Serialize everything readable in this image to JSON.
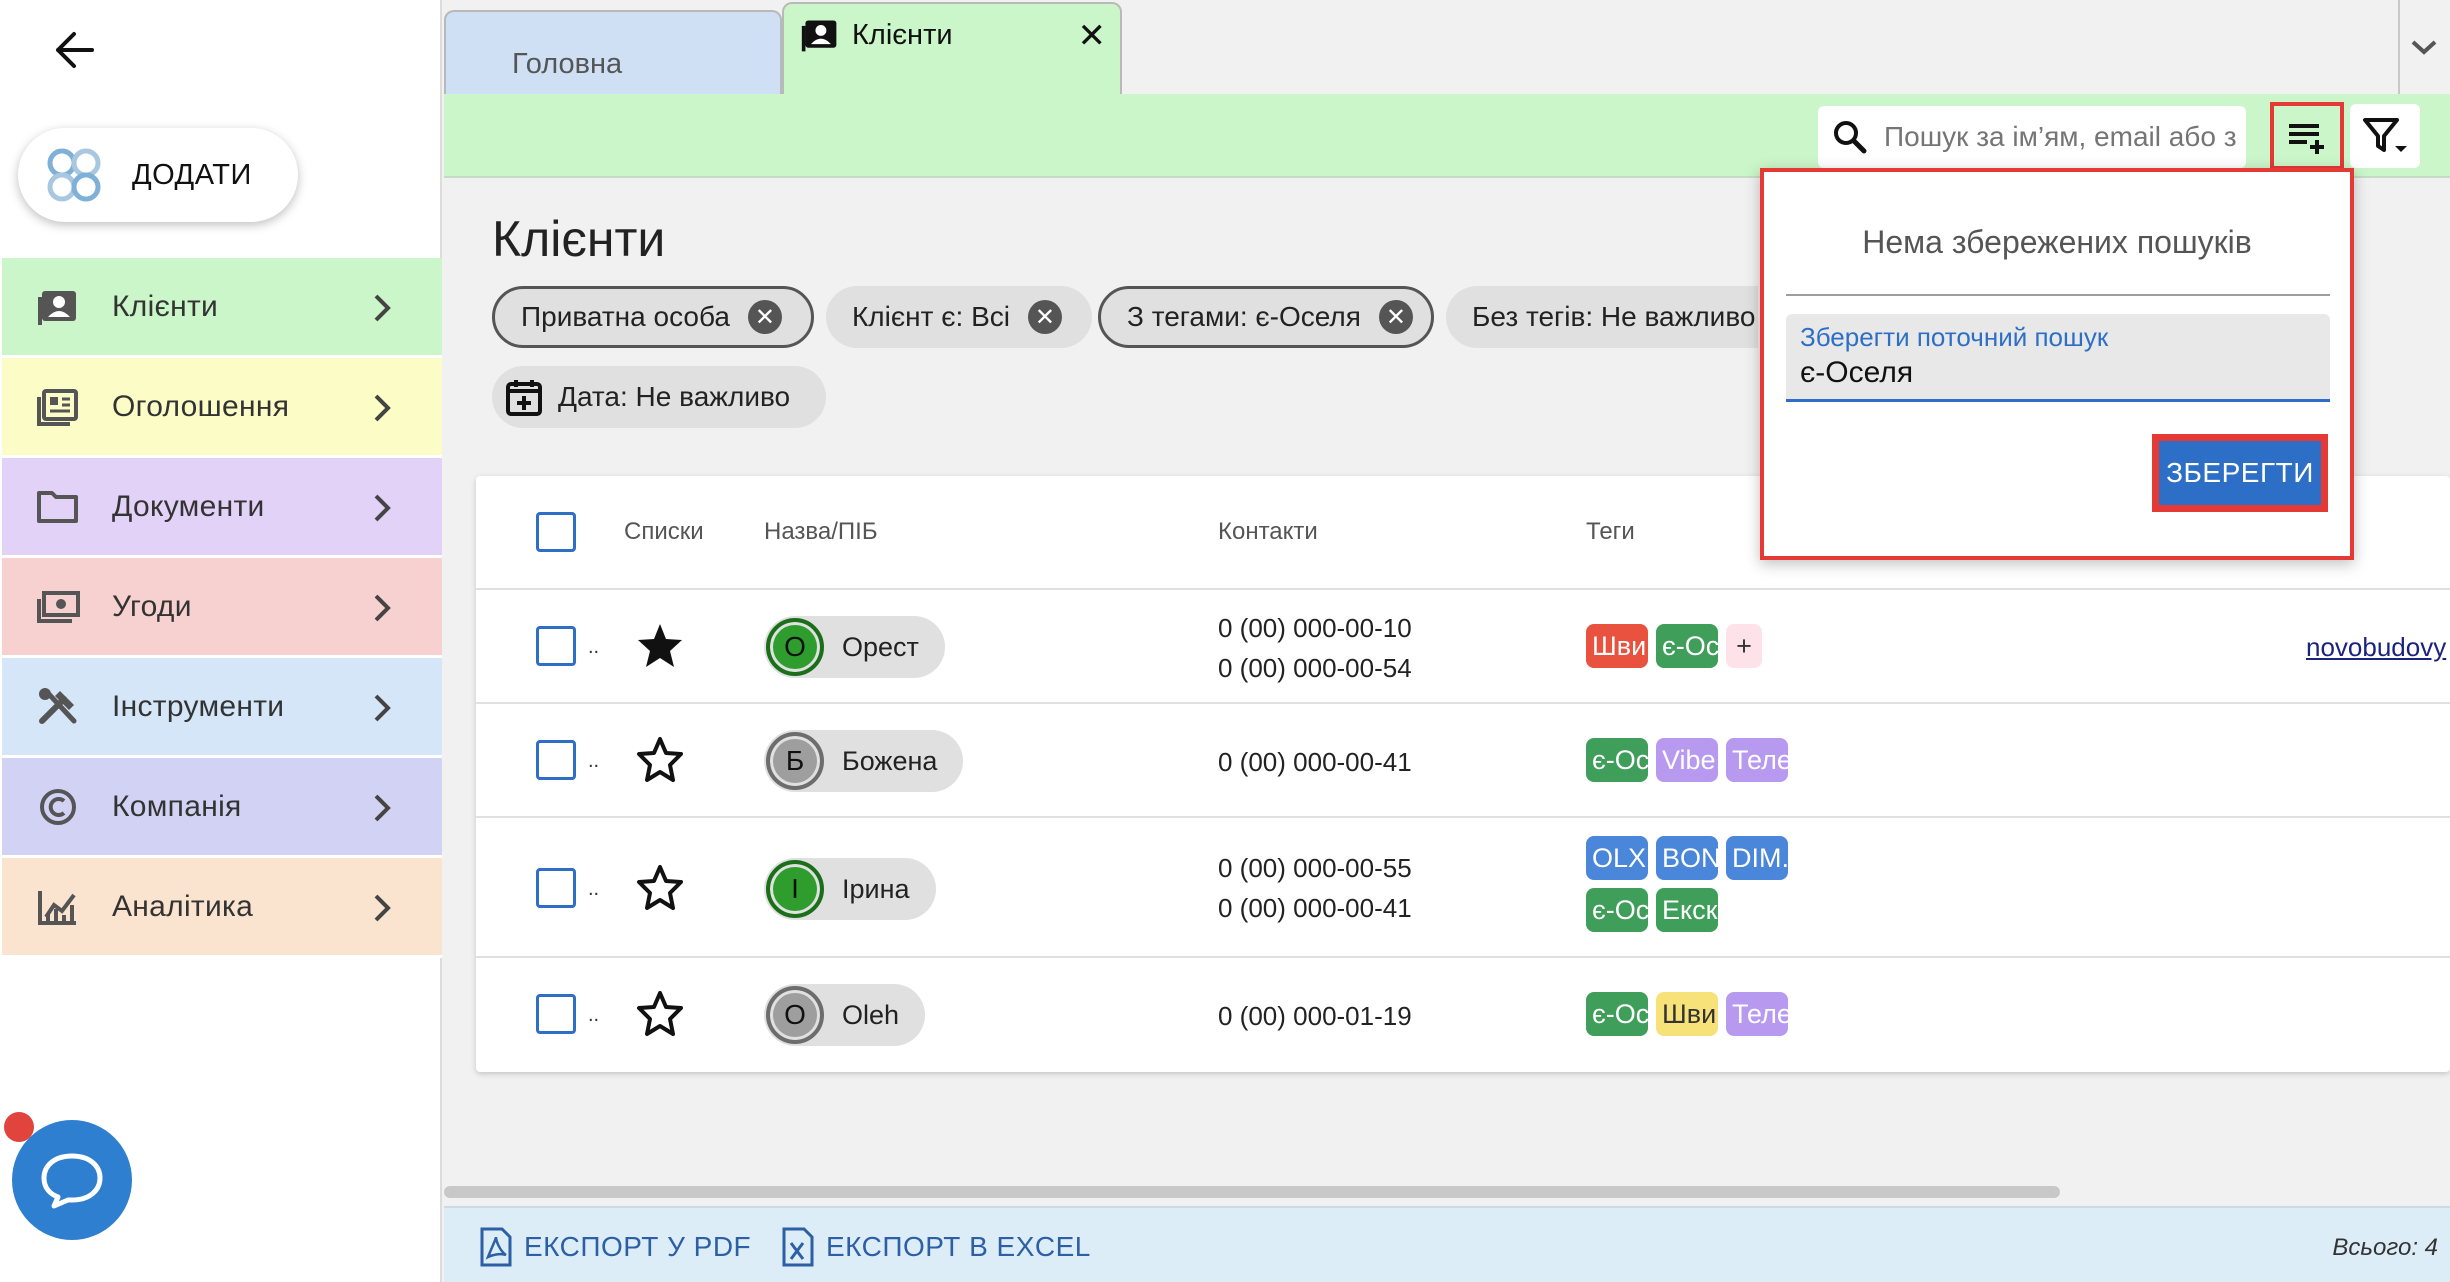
{
  "sidebar": {
    "add_label": "ДОДАТИ",
    "items": [
      {
        "label": "Клієнти",
        "icon": "contact-card-icon",
        "color": "#cbf6c9"
      },
      {
        "label": "Оголошення",
        "icon": "listing-icon",
        "color": "#fcfcc6"
      },
      {
        "label": "Документи",
        "icon": "folder-icon",
        "color": "#e2d2f7"
      },
      {
        "label": "Угоди",
        "icon": "money-icon",
        "color": "#f7d0d0"
      },
      {
        "label": "Інструменти",
        "icon": "tools-icon",
        "color": "#d4e6f8"
      },
      {
        "label": "Компанія",
        "icon": "copyright-icon",
        "color": "#d2d2f5"
      },
      {
        "label": "Аналітика",
        "icon": "analytics-icon",
        "color": "#fae3cf"
      }
    ]
  },
  "tabs": {
    "home": "Головна",
    "clients": "Клієнти",
    "close": "✕"
  },
  "toolbar": {
    "search_placeholder": "Пошук за ім’ям, email або з"
  },
  "page": {
    "title": "Клієнти",
    "chips": [
      {
        "label": "Приватна особа",
        "style": "outlined",
        "closable": true
      },
      {
        "label": "Клієнт є: Всі",
        "style": "plain",
        "closable": true
      },
      {
        "label": "З тегами: є-Оселя",
        "style": "outlined",
        "closable": true
      },
      {
        "label": "Без тегів: Не важливо",
        "style": "plain",
        "closable": false
      },
      {
        "label": "Дата: Не важливо",
        "style": "plain",
        "closable": false
      }
    ]
  },
  "table": {
    "headers": {
      "lists": "Списки",
      "name": "Назва/ПІБ",
      "contacts": "Контакти",
      "tags": "Теги"
    },
    "rows": [
      {
        "initial": "О",
        "name": "Орест",
        "avatar": "green",
        "starred": true,
        "contacts": [
          "0 (00) 000-00-10",
          "0 (00) 000-00-54"
        ],
        "tags": [
          {
            "text": "Шви",
            "color": "#e8523f"
          },
          {
            "text": "є-Ос",
            "color": "#3f9e5a"
          },
          {
            "text": "+",
            "color": "#fde2ea"
          }
        ],
        "link": "novobudovy"
      },
      {
        "initial": "Б",
        "name": "Божена",
        "avatar": "gray",
        "starred": false,
        "contacts": [
          "0 (00) 000-00-41"
        ],
        "tags": [
          {
            "text": "є-Ос",
            "color": "#3f9e5a"
          },
          {
            "text": "Vibe",
            "color": "#b79af0"
          },
          {
            "text": "Теле",
            "color": "#b79af0"
          }
        ],
        "link": ""
      },
      {
        "initial": "І",
        "name": "Ірина",
        "avatar": "green",
        "starred": false,
        "contacts": [
          "0 (00) 000-00-55",
          "0 (00) 000-00-41"
        ],
        "tags": [
          {
            "text": "OLX",
            "color": "#4a86d9"
          },
          {
            "text": "BON",
            "color": "#4a86d9"
          },
          {
            "text": "DIM.",
            "color": "#4a86d9"
          },
          {
            "text": "є-Ос",
            "color": "#3f9e5a"
          },
          {
            "text": "Екск",
            "color": "#3f9e5a"
          }
        ],
        "link": ""
      },
      {
        "initial": "О",
        "name": "Oleh",
        "avatar": "gray",
        "starred": false,
        "contacts": [
          "0 (00) 000-01-19"
        ],
        "tags": [
          {
            "text": "є-Ос",
            "color": "#3f9e5a"
          },
          {
            "text": "Шви",
            "color": "#f7e27a"
          },
          {
            "text": "Теле",
            "color": "#b79af0"
          }
        ],
        "link": ""
      }
    ],
    "row_dots": ".."
  },
  "footer": {
    "export_pdf": "ЕКСПОРТ У PDF",
    "export_excel": "ЕКСПОРТ В EXCEL",
    "total": "Всього: 4"
  },
  "popover": {
    "empty_text": "Нема збережених пошуків",
    "field_label": "Зберегти поточний пошук",
    "field_value": "є-Оселя",
    "save_label": "ЗБЕРЕГТИ"
  },
  "colors": {
    "accent_blue": "#2d6fc6",
    "highlight_red": "#e53935",
    "clients_green": "#cbf6c9"
  }
}
